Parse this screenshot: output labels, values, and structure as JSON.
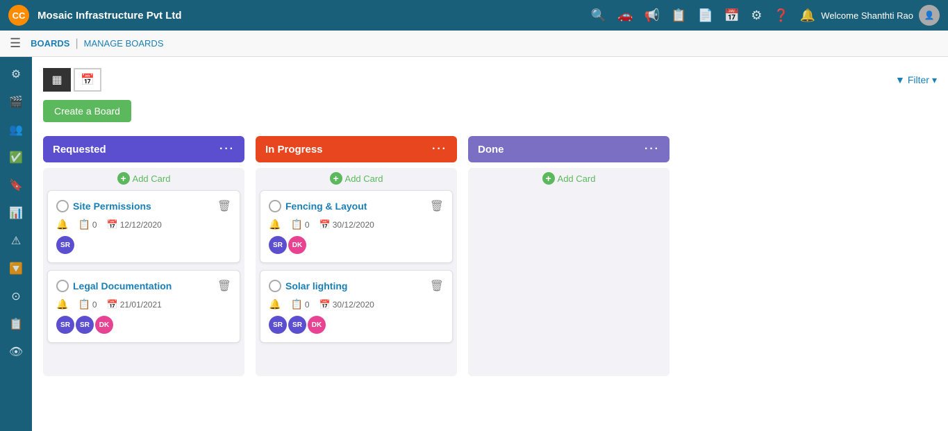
{
  "header": {
    "logo": "CC",
    "company_name": "Mosaic Infrastructure Pvt Ltd",
    "welcome_text": "Welcome Shanthti Rao",
    "icons": [
      "🔍",
      "🚗",
      "📢",
      "📋",
      "📄",
      "📅",
      "⚙",
      "❓",
      "🔔"
    ]
  },
  "nav": {
    "boards_label": "BOARDS",
    "manage_boards_label": "MANAGE BOARDS",
    "filter_label": "Filter"
  },
  "toolbar": {
    "create_board_label": "Create a Board"
  },
  "columns": [
    {
      "id": "requested",
      "header": "Requested",
      "theme": "requested",
      "add_card_label": "Add Card",
      "cards": [
        {
          "id": "site-permissions",
          "title": "Site Permissions",
          "checklist_count": "0",
          "date": "12/12/2020",
          "avatars": [
            "SR"
          ]
        },
        {
          "id": "legal-documentation",
          "title": "Legal Documentation",
          "checklist_count": "0",
          "date": "21/01/2021",
          "avatars": [
            "SR",
            "SR",
            "DK"
          ]
        }
      ]
    },
    {
      "id": "in-progress",
      "header": "In Progress",
      "theme": "inprogress",
      "add_card_label": "Add Card",
      "cards": [
        {
          "id": "fencing-layout",
          "title": "Fencing & Layout",
          "checklist_count": "0",
          "date": "30/12/2020",
          "avatars": [
            "SR",
            "DK"
          ]
        },
        {
          "id": "solar-lighting",
          "title": "Solar lighting",
          "checklist_count": "0",
          "date": "30/12/2020",
          "avatars": [
            "SR",
            "SR",
            "DK"
          ]
        }
      ]
    },
    {
      "id": "done",
      "header": "Done",
      "theme": "done",
      "add_card_label": "Add Card",
      "cards": []
    }
  ],
  "sidebar": {
    "items": [
      {
        "name": "settings-icon",
        "icon": "⚙"
      },
      {
        "name": "video-icon",
        "icon": "🎬"
      },
      {
        "name": "people-icon",
        "icon": "👥"
      },
      {
        "name": "checklist-icon",
        "icon": "✅"
      },
      {
        "name": "bookmark-icon",
        "icon": "🔖"
      },
      {
        "name": "chart-icon",
        "icon": "📊"
      },
      {
        "name": "alert-icon",
        "icon": "⚠"
      },
      {
        "name": "filter-icon",
        "icon": "🔽"
      },
      {
        "name": "circle-icon",
        "icon": "⊙"
      },
      {
        "name": "clipboard-icon",
        "icon": "📋"
      },
      {
        "name": "eye-icon",
        "icon": "👁"
      }
    ]
  }
}
